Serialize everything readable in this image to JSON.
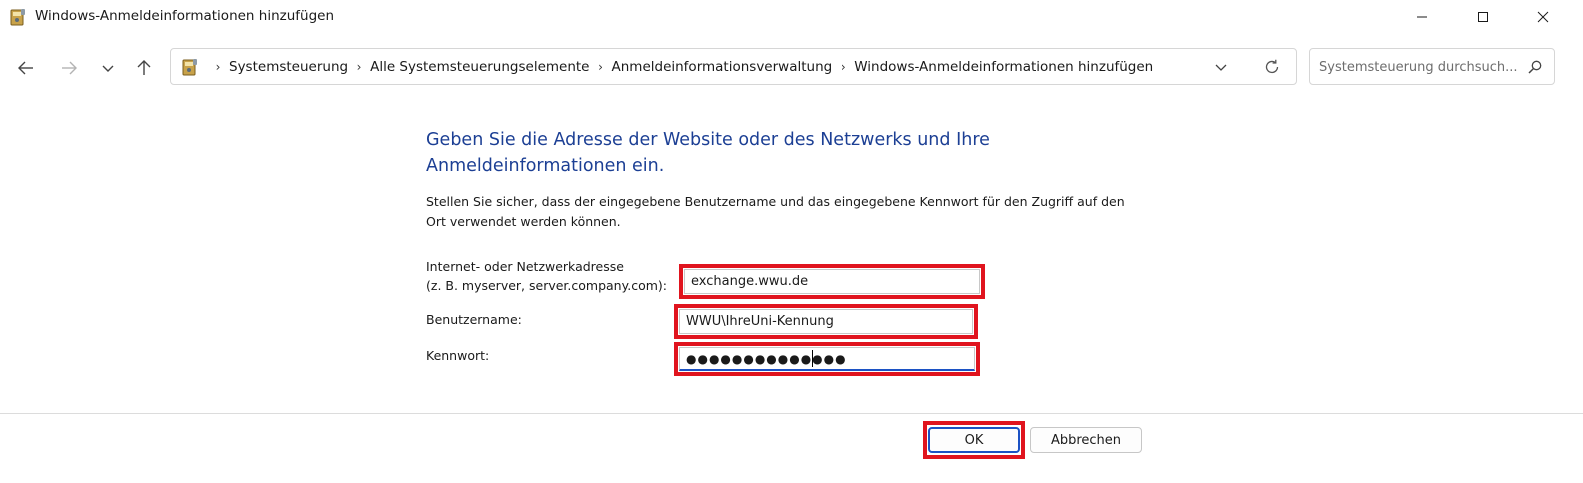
{
  "window": {
    "title": "Windows-Anmeldeinformationen hinzufügen"
  },
  "address_bar": {
    "breadcrumbs": [
      "Systemsteuerung",
      "Alle Systemsteuerungselemente",
      "Anmeldeinformationsverwaltung",
      "Windows-Anmeldeinformationen hinzufügen"
    ]
  },
  "search": {
    "placeholder": "Systemsteuerung durchsuch..."
  },
  "form": {
    "heading": "Geben Sie die Adresse der Website oder des Netzwerks und Ihre Anmeldeinformationen ein.",
    "description": "Stellen Sie sicher, dass der eingegebene Benutzername und das eingegebene Kennwort für den Zugriff auf den Ort verwendet werden können.",
    "address_label": "Internet- oder Netzwerkadresse",
    "address_hint": "(z. B. myserver, server.company.com):",
    "address_value": "exchange.wwu.de",
    "username_label": "Benutzername:",
    "username_value": "WWU\\IhreUni-Kennung",
    "password_label": "Kennwort:",
    "password_masked": "●●●●●●●●●●●●●●"
  },
  "buttons": {
    "ok_label": "OK",
    "cancel_label": "Abbrechen"
  },
  "colors": {
    "heading": "#1c3f94",
    "highlight": "#e0141e",
    "focus": "#1c52c4"
  }
}
